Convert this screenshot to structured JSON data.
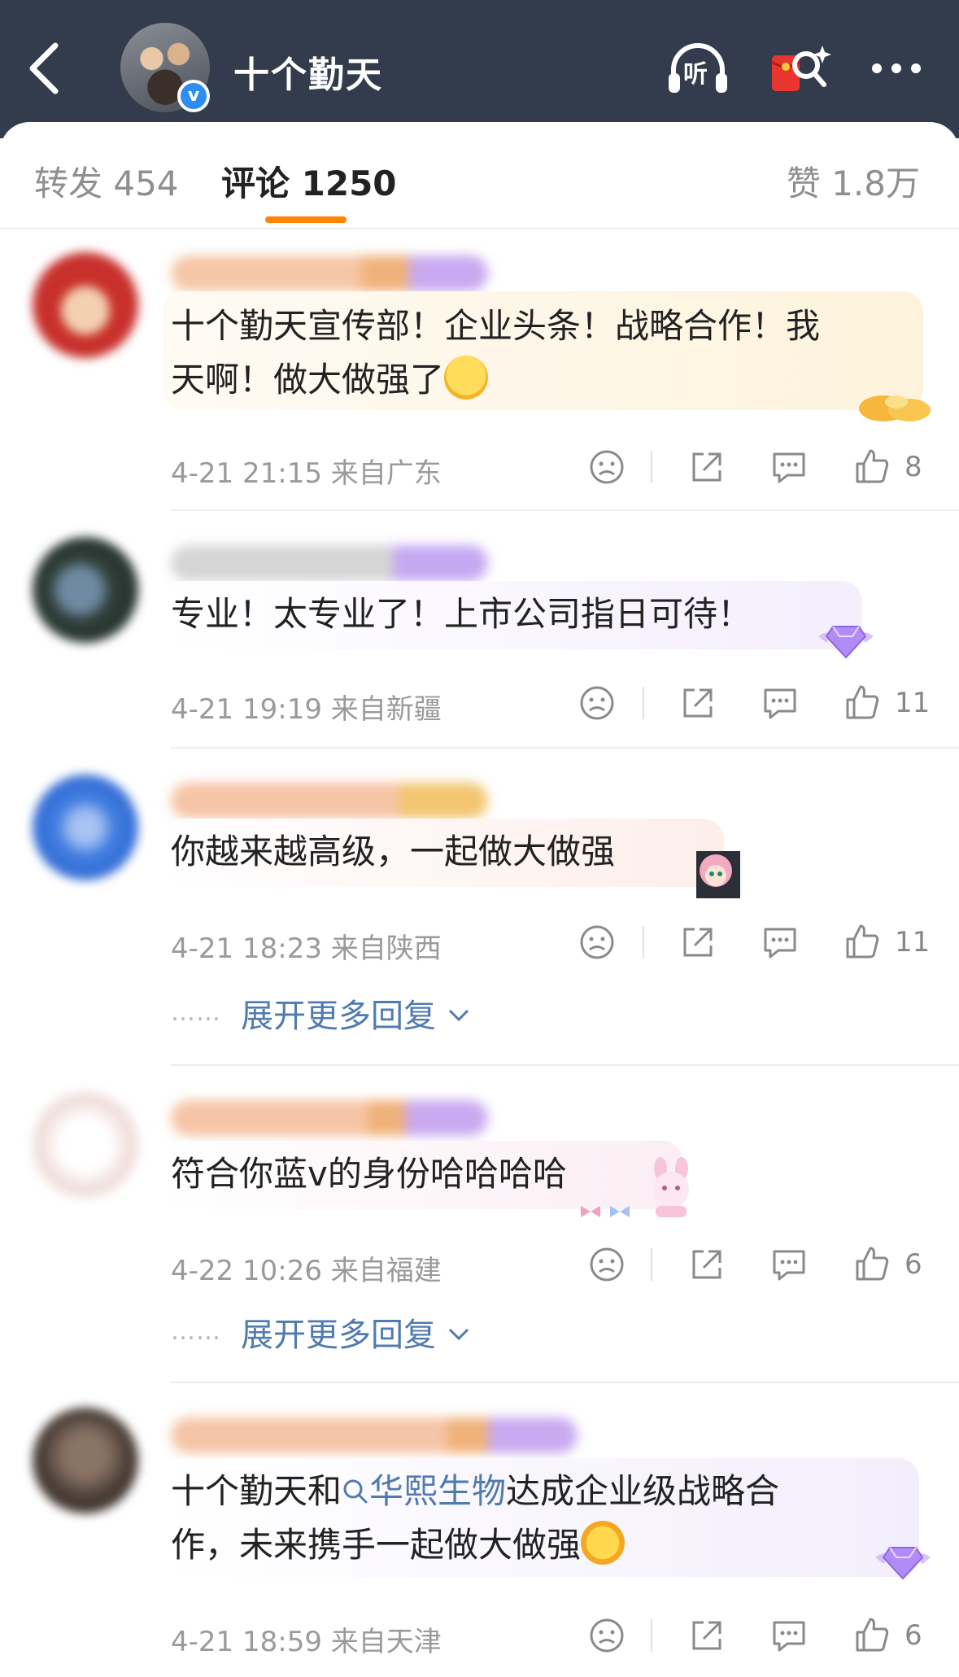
{
  "header": {
    "title": "十个勤天",
    "listen_label": "听",
    "colors": {
      "bar": "#333c4c",
      "accent": "#ff8200",
      "link": "#4f7bb0"
    }
  },
  "tabs": {
    "repost": "转发 454",
    "comments": "评论 1250",
    "likes": "赞 1.8万"
  },
  "comments": [
    {
      "text_line1": "十个勤天宣传部！企业头条！战略合作！我",
      "text_line2": "天啊！做大做强了",
      "time": "4-21 21:15",
      "location": "来自广东",
      "likes": "8"
    },
    {
      "text_line1": "专业！太专业了！上市公司指日可待！",
      "time": "4-21 19:19",
      "location": "来自新疆",
      "likes": "11"
    },
    {
      "text_line1": "你越来越高级，一起做大做强",
      "time": "4-21 18:23",
      "location": "来自陕西",
      "likes": "11",
      "more_dots": "……",
      "more_link": "展开更多回复"
    },
    {
      "text_line1": "符合你蓝v的身份哈哈哈哈",
      "time": "4-22 10:26",
      "location": "来自福建",
      "likes": "6",
      "more_dots": "……",
      "more_link": "展开更多回复"
    },
    {
      "text_prefix": "十个勤天和",
      "topic": "华熙生物",
      "text_suffix": "达成企业级战略合",
      "text_line2": "作，未来携手一起做大做强",
      "time": "4-21 18:59",
      "location": "来自天津",
      "likes": "6"
    }
  ],
  "icons": [
    "back-icon",
    "listen-icon",
    "red-envelope-icon",
    "more-icon",
    "dislike-icon",
    "share-icon",
    "comment-icon",
    "like-icon",
    "search-icon",
    "chevron-down-icon"
  ]
}
